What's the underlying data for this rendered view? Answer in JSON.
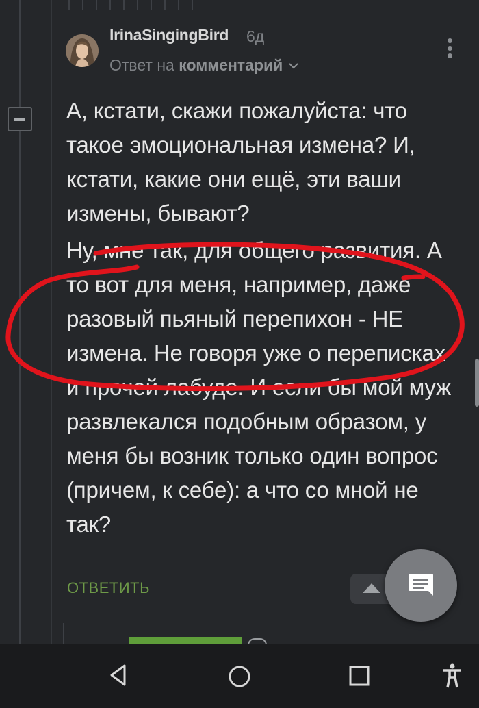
{
  "comment": {
    "username": "IrinaSingingBird",
    "time": "6д",
    "reply_prefix": "Ответ на",
    "reply_target": "комментарий",
    "paragraphs": [
      "А, кстати, скажи пожалуйста: что такое эмоциональная измена? И, кстати, какие они ещё, эти ваши измены, бывают?",
      "Ну, мне так, для общего развития. А то вот для меня, например, даже разовый пьяный перепихон - НЕ измена. Не говоря уже о переписках и прочей лабуде. И если бы мой муж развлекался подобным образом, у меня бы возник только один вопрос (причем, к себе): а что со мной не так?"
    ],
    "reply_button": "ОТВЕТИТЬ"
  },
  "colors": {
    "background": "#25272a",
    "text": "#e6e6e6",
    "muted": "#7e8185",
    "reply_green": "#6e9a48",
    "highlight_red": "#e0141c",
    "nav_bar": "#1a1b1d"
  },
  "icons": {
    "more": "more-vertical-icon",
    "reply_chevron": "chevron-down-icon",
    "fab": "comment-icon",
    "scroll_up": "caret-up-icon",
    "collapse": "minus-icon",
    "nav": [
      "back-icon",
      "home-icon",
      "recents-icon",
      "accessibility-icon"
    ]
  }
}
